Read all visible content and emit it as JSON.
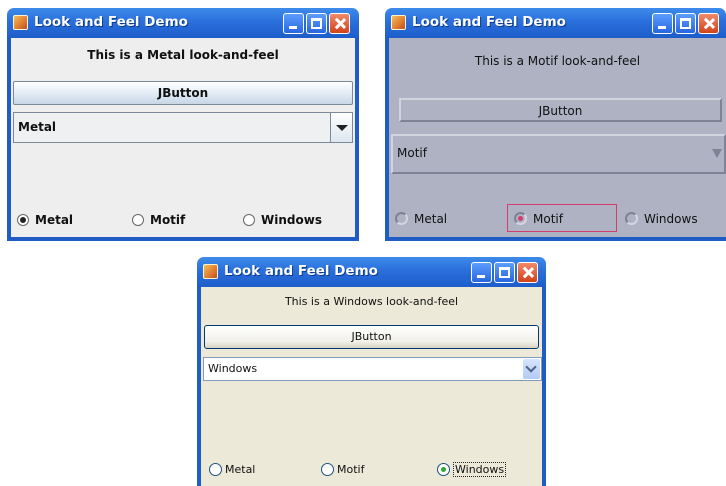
{
  "windows": [
    {
      "title": "Look and Feel Demo",
      "label": "This is a Metal look-and-feel",
      "button": "JButton",
      "combo_value": "Metal",
      "radios": [
        {
          "label": "Metal",
          "selected": true
        },
        {
          "label": "Motif",
          "selected": false
        },
        {
          "label": "Windows",
          "selected": false
        }
      ]
    },
    {
      "title": "Look and Feel Demo",
      "label": "This is a Motif look-and-feel",
      "button": "JButton",
      "combo_value": "Motif",
      "radios": [
        {
          "label": "Metal",
          "selected": false
        },
        {
          "label": "Motif",
          "selected": true
        },
        {
          "label": "Windows",
          "selected": false
        }
      ]
    },
    {
      "title": "Look and Feel Demo",
      "label": "This is a Windows look-and-feel",
      "button": "JButton",
      "combo_value": "Windows",
      "radios": [
        {
          "label": "Metal",
          "selected": false
        },
        {
          "label": "Motif",
          "selected": false
        },
        {
          "label": "Windows",
          "selected": true
        }
      ]
    }
  ],
  "colors": {
    "titlebar": "#2a6fdc",
    "metal_bg": "#eeeeee",
    "motif_bg": "#aeb2c3",
    "windows_bg": "#ece9d8",
    "motif_selected": "#d43c6c",
    "windows_selected": "#2faa2f"
  }
}
